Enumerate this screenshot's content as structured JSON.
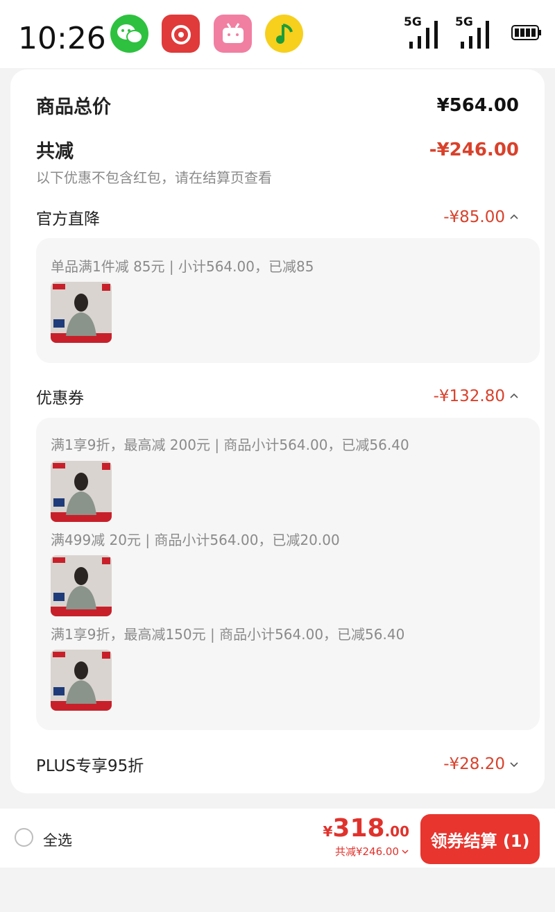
{
  "status_bar": {
    "time": "10:26",
    "network_1": "5G",
    "network_2": "5G",
    "apps": [
      "wechat-icon",
      "netease-music-icon",
      "bilibili-icon",
      "qq-music-icon"
    ]
  },
  "summary": {
    "goods_total_label": "商品总价",
    "goods_total_value": "¥564.00",
    "total_discount_label": "共减",
    "total_discount_value": "-¥246.00",
    "note": "以下优惠不包含红包，请在结算页查看"
  },
  "official_drop": {
    "label": "官方直降",
    "value": "-¥85.00",
    "detail": "单品满1件减 85元 | 小计564.00，已减85"
  },
  "coupons": {
    "label": "优惠券",
    "value": "-¥132.80",
    "items": [
      "满1享9折，最高减 200元 | 商品小计564.00，已减56.40",
      "满499减 20元 | 商品小计564.00，已减20.00",
      "满1享9折，最高减150元 | 商品小计564.00，已减56.40"
    ]
  },
  "plus": {
    "label": "PLUS专享95折",
    "value": "-¥28.20"
  },
  "bottom": {
    "select_all": "全选",
    "currency": "¥",
    "total_int": "318",
    "total_dec": ".00",
    "reduced": "共减¥246.00",
    "checkout": "领券结算 (1)"
  },
  "colors": {
    "accent_red": "#d9412b",
    "button_red": "#e8352e"
  }
}
